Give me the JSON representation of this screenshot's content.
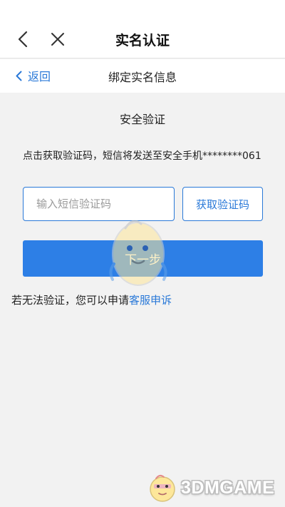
{
  "header": {
    "title": "实名认证",
    "back_icon": "chevron-left-icon",
    "close_icon": "close-icon"
  },
  "subheader": {
    "back_label": "返回",
    "title": "绑定实名信息"
  },
  "verification": {
    "section_title": "安全验证",
    "notice": "点击获取验证码，短信将发送至安全手机********061",
    "code_input": {
      "value": "",
      "placeholder": "输入短信验证码"
    },
    "get_code_label": "获取验证码",
    "next_label": "下一步"
  },
  "help": {
    "prefix": "若无法验证，您可以申请",
    "link_label": "客服申诉"
  },
  "watermark": {
    "text": "3DMGAME"
  },
  "colors": {
    "accent": "#2a79d8",
    "primary_button": "#2d7fe6",
    "background": "#f2f2f2"
  }
}
